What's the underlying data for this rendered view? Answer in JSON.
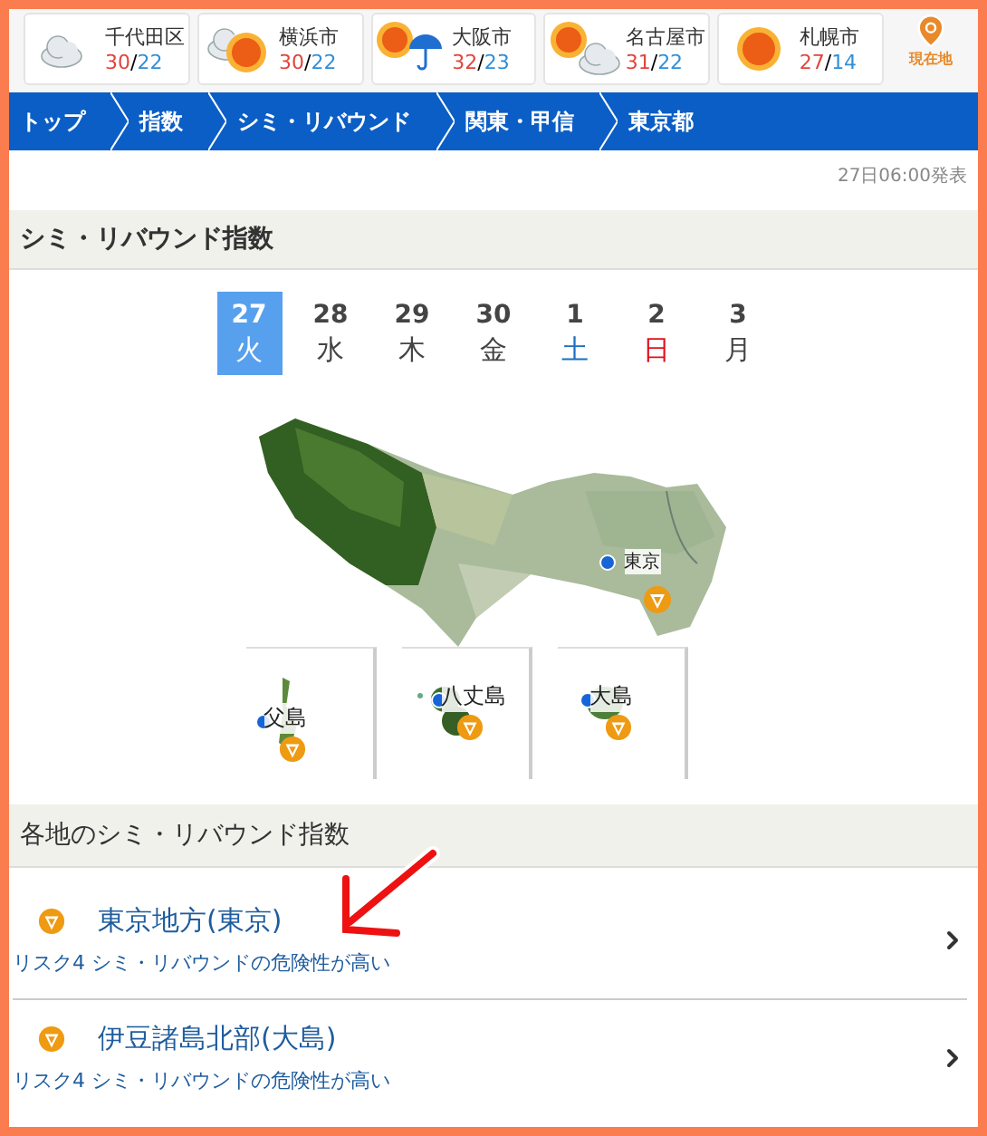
{
  "weather": [
    {
      "city": "千代田区",
      "high": "30",
      "separator": "/",
      "low": "22",
      "kind": "cloudy"
    },
    {
      "city": "横浜市",
      "high": "30",
      "separator": "/",
      "low": "22",
      "kind": "clearing"
    },
    {
      "city": "大阪市",
      "high": "32",
      "separator": "/",
      "low": "23",
      "kind": "rainy"
    },
    {
      "city": "名古屋市",
      "high": "31",
      "separator": "/",
      "low": "22",
      "kind": "clouding"
    },
    {
      "city": "札幌市",
      "high": "27",
      "separator": "/",
      "low": "14",
      "kind": "sunny"
    }
  ],
  "current_location": "現在地",
  "breadcrumb": [
    "トップ",
    "指数",
    "シミ・リバウンド",
    "関東・甲信",
    "東京都"
  ],
  "published": "27日06:00発表",
  "index_title": "シミ・リバウンド指数",
  "days": [
    {
      "date": "27",
      "weekday": "火",
      "kind": "weekday",
      "selected": true
    },
    {
      "date": "28",
      "weekday": "水",
      "kind": "weekday",
      "selected": false
    },
    {
      "date": "29",
      "weekday": "木",
      "kind": "weekday",
      "selected": false
    },
    {
      "date": "30",
      "weekday": "金",
      "kind": "weekday",
      "selected": false
    },
    {
      "date": "1",
      "weekday": "土",
      "kind": "saturday",
      "selected": false
    },
    {
      "date": "2",
      "weekday": "日",
      "kind": "sunday",
      "selected": false
    },
    {
      "date": "3",
      "weekday": "月",
      "kind": "weekday",
      "selected": false
    }
  ],
  "map_marker": {
    "label": "東京"
  },
  "islands": [
    {
      "label": "父島"
    },
    {
      "label": "八丈島"
    },
    {
      "label": "大島"
    }
  ],
  "regions_title": "各地のシミ・リバウンド指数",
  "regions": [
    {
      "name": "東京地方(東京)",
      "description": "リスク4 シミ・リバウンドの危険性が高い"
    },
    {
      "name": "伊豆諸島北部(大島)",
      "description": "リスク4 シミ・リバウンドの危険性が高い"
    }
  ]
}
